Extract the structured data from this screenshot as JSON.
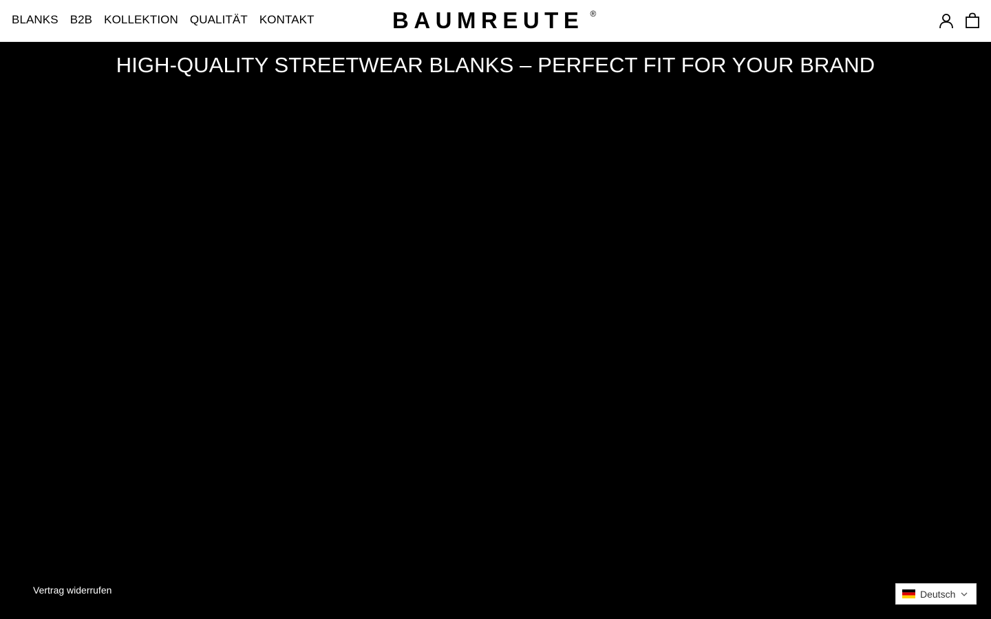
{
  "header": {
    "nav": [
      "BLANKS",
      "B2B",
      "KOLLEKTION",
      "QUALITÄT",
      "KONTAKT"
    ],
    "logo_text": "BAUMREUTE",
    "logo_mark": "®",
    "icons": [
      "account-icon",
      "cart-icon"
    ]
  },
  "hero": {
    "title": "HIGH-QUALITY STREETWEAR BLANKS – PERFECT FIT FOR YOUR BRAND"
  },
  "footer": {
    "withdraw_label": "Vertrag widerrufen"
  },
  "language": {
    "selected": "Deutsch",
    "flag": "de-flag-icon"
  },
  "colors": {
    "header_bg": "#ffffff",
    "hero_bg": "#000000",
    "text_on_dark": "#ffffff"
  }
}
